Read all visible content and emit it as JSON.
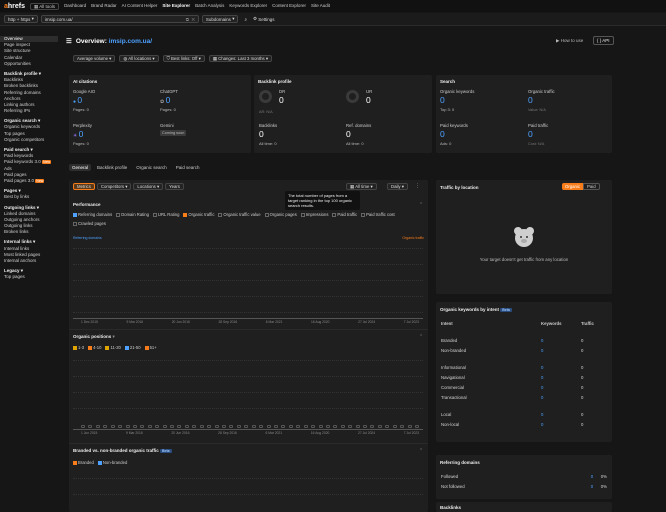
{
  "topbar": {
    "logo_a": "a",
    "logo_rest": "hrefs",
    "all_tools": "All tools",
    "nav": [
      "Dashboard",
      "Brand Radar",
      "AI Content Helper",
      "Site Explorer",
      "Batch Analysis",
      "Keywords Explorer",
      "Content Explorer",
      "Site Audit"
    ],
    "active_nav": "Site Explorer"
  },
  "urlbar": {
    "protocol": "http + https",
    "url": "imsip.com.ua/",
    "mode": "Subdomains",
    "settings": "Settings"
  },
  "sidebar": {
    "groups": [
      {
        "heading": "",
        "items": [
          "Overview",
          "Page inspect",
          "Site structure",
          "Calendar",
          "Opportunities"
        ]
      },
      {
        "heading": "Backlink profile",
        "items": [
          "Backlinks",
          "Broken backlinks",
          "Referring domains",
          "Anchors",
          "Linking authors",
          "Referring IPs"
        ]
      },
      {
        "heading": "Organic search",
        "items": [
          "Organic keywords",
          "Top pages",
          "Organic competitors"
        ]
      },
      {
        "heading": "Paid search",
        "items": [
          "Paid keywords",
          "Paid keywords 3.0",
          "Ads",
          "Paid pages",
          "Paid pages 3.0"
        ]
      },
      {
        "heading": "Pages",
        "items": [
          "Best by links"
        ]
      },
      {
        "heading": "Outgoing links",
        "items": [
          "Linked domains",
          "Outgoing anchors",
          "Outgoing links",
          "Broken links"
        ]
      },
      {
        "heading": "Internal links",
        "items": [
          "Internal links",
          "Most linked pages",
          "Internal anchors"
        ]
      },
      {
        "heading": "Legacy",
        "items": [
          "Top pages"
        ]
      }
    ],
    "new_badge": "New"
  },
  "header": {
    "title_prefix": "Overview: ",
    "title_domain": "imsip.com.ua/",
    "how_to_use": "How to use",
    "api": "{ } API"
  },
  "filters": {
    "volume": "Average volume",
    "locations": "All locations",
    "best_links": "Best links: Off",
    "changes": "Changes: Last 3 months"
  },
  "ai_citations": {
    "title": "AI citations",
    "google_label": "Google AIO",
    "google_value": "0",
    "google_pages": "Pages: 0",
    "chatgpt_label": "ChatGPT",
    "chatgpt_value": "0",
    "chatgpt_pages": "Pages: 0",
    "perplexity_label": "Perplexity",
    "perplexity_value": "0",
    "perplexity_pages": "Pages: 0",
    "gemini_label": "Gemini",
    "gemini_badge": "Coming soon"
  },
  "backlink_profile": {
    "title": "Backlink profile",
    "dr_label": "DR",
    "dr_value": "0",
    "dr_sub": "AR: N/A",
    "ur_label": "UR",
    "ur_value": "0",
    "backlinks_label": "Backlinks",
    "backlinks_value": "0",
    "backlinks_sub": "All time: 0",
    "refdomains_label": "Ref. domains",
    "refdomains_value": "0",
    "refdomains_sub": "All time: 0"
  },
  "search": {
    "title": "Search",
    "ok_label": "Organic keywords",
    "ok_value": "0",
    "ok_sub": "Top 3: 0",
    "ot_label": "Organic traffic",
    "ot_value": "0",
    "ot_sub": "Value: N/A",
    "pk_label": "Paid keywords",
    "pk_value": "0",
    "pk_sub": "Ads: 0",
    "pt_label": "Paid traffic",
    "pt_value": "0",
    "pt_sub": "Cost: N/A"
  },
  "tabs": [
    "General",
    "Backlink profile",
    "Organic search",
    "Paid search"
  ],
  "perf_toolbar": {
    "tabs": [
      "Metrics",
      "Competitors",
      "Locations",
      "Years"
    ],
    "all_time": "All time",
    "daily": "Daily"
  },
  "tooltip": "The total number of pages from a target ranking in the top 100 organic search results.",
  "performance": {
    "title": "Performance",
    "checks": [
      {
        "label": "Referring domains",
        "state": "on"
      },
      {
        "label": "Domain Rating",
        "state": "off"
      },
      {
        "label": "URL Rating",
        "state": "off"
      },
      {
        "label": "Organic traffic",
        "state": "or"
      },
      {
        "label": "Organic traffic value",
        "state": "off"
      },
      {
        "label": "Organic pages",
        "state": "off"
      },
      {
        "label": "Impressions",
        "state": "off"
      },
      {
        "label": "Paid traffic",
        "state": "off"
      },
      {
        "label": "Paid traffic cost",
        "state": "off"
      },
      {
        "label": "Crawled pages",
        "state": "off"
      }
    ],
    "left_axis": "Referring domains",
    "right_axis": "Organic traffic",
    "dates": [
      "1 Dec 2015",
      "9 Mar 2016",
      "20 Jun 2016",
      "28 Sep 2016",
      "6 Mar 2021",
      "16 Aug 2020",
      "27 Jul 2024",
      "7 Jul 2023"
    ]
  },
  "positions": {
    "title": "Organic positions",
    "checks": [
      "1-3",
      "4-10",
      "11-20",
      "21-50",
      "51+"
    ],
    "dates": [
      "1 Jun 2015",
      "9 Mar 2016",
      "20 Jun 2016",
      "28 Sep 2016",
      "6 Mar 2021",
      "16 Aug 2020",
      "27 Jul 2024",
      "7 Jul 2023"
    ]
  },
  "branded": {
    "title": "Branded vs. non-branded organic traffic",
    "beta": "Beta",
    "checks": [
      "Branded",
      "Non-branded"
    ]
  },
  "traffic_location": {
    "title": "Traffic by location",
    "organic": "Organic",
    "paid": "Paid",
    "empty": "Your target doesn't get traffic from any location"
  },
  "intent": {
    "title": "Organic keywords by intent",
    "beta": "Beta",
    "headers": [
      "Intent",
      "Keywords",
      "Traffic"
    ],
    "rows": [
      [
        "Branded",
        "0",
        "0"
      ],
      [
        "Non-branded",
        "0",
        "0"
      ],
      [
        "Informational",
        "0",
        "0"
      ],
      [
        "Navigational",
        "0",
        "0"
      ],
      [
        "Commercial",
        "0",
        "0"
      ],
      [
        "Transactional",
        "0",
        "0"
      ],
      [
        "Local",
        "0",
        "0"
      ],
      [
        "Non-local",
        "0",
        "0"
      ]
    ]
  },
  "refdomains": {
    "title": "Referring domains",
    "rows": [
      [
        "Followed",
        "0",
        "0%"
      ],
      [
        "Not followed",
        "0",
        "0%"
      ]
    ]
  },
  "backlinks_title": "Backlinks"
}
